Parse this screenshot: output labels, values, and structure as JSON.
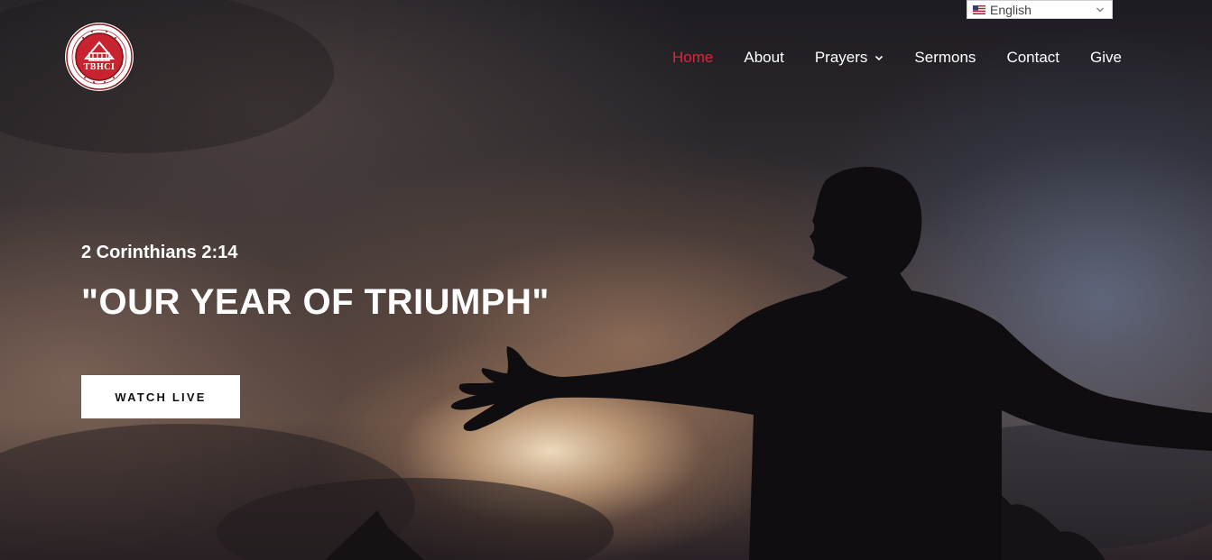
{
  "header": {
    "logo": {
      "text": "TBHCI",
      "ring_text": "THE BUILDER'S HOUSE CHAPEL · INTERNATIONAL",
      "brand_color": "#c8242f"
    },
    "nav": {
      "items": [
        {
          "label": "Home",
          "active": true
        },
        {
          "label": "About"
        },
        {
          "label": "Prayers",
          "has_dropdown": true
        },
        {
          "label": "Sermons"
        },
        {
          "label": "Contact"
        },
        {
          "label": "Give"
        }
      ],
      "active_color": "#e0243a"
    },
    "language": {
      "selected": "English",
      "flag_icon": "us-flag-icon"
    }
  },
  "hero": {
    "verse": "2 Corinthians 2:14",
    "headline": "\"OUR YEAR OF TRIUMPH\"",
    "cta_label": "WATCH LIVE"
  }
}
